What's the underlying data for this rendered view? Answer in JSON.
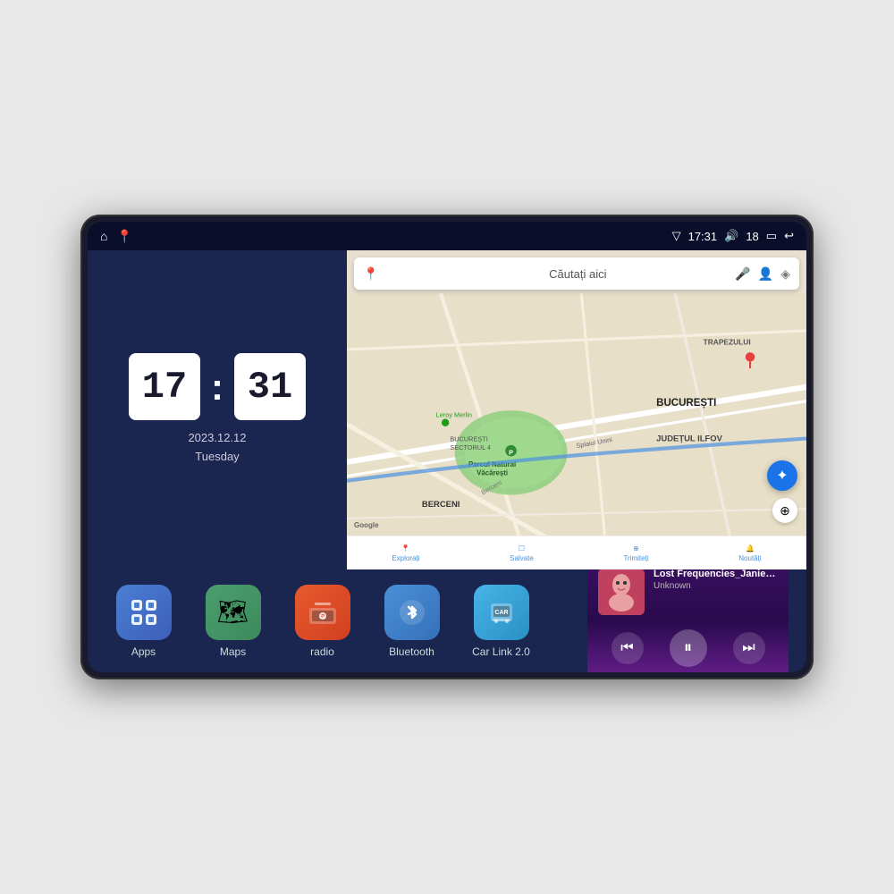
{
  "device": {
    "status_bar": {
      "signal_icon": "▽",
      "time": "17:31",
      "volume_icon": "🔊",
      "battery_level": "18",
      "battery_icon": "▭",
      "back_icon": "↩"
    },
    "home_button": "⌂",
    "maps_shortcut_icon": "📍"
  },
  "clock": {
    "hours": "17",
    "minutes": "31",
    "date": "2023.12.12",
    "day": "Tuesday"
  },
  "map": {
    "search_placeholder": "Căutați aici",
    "nav_items": [
      {
        "label": "Explorați",
        "icon": "📍"
      },
      {
        "label": "Salvate",
        "icon": "☐"
      },
      {
        "label": "Trimiteți",
        "icon": "⊕"
      },
      {
        "label": "Noutăți",
        "icon": "🔔"
      }
    ],
    "labels": [
      "BUCUREȘTI",
      "JUDEȚUL ILFOV",
      "TRAPEZULUI",
      "BERCENI",
      "BUCUREȘTI SECTORUL 4"
    ],
    "google_label": "Google"
  },
  "apps": [
    {
      "id": "apps",
      "label": "Apps",
      "icon": "⊞",
      "bg": "apps-icon-bg"
    },
    {
      "id": "maps",
      "label": "Maps",
      "icon": "🗺",
      "bg": "maps-icon-bg"
    },
    {
      "id": "radio",
      "label": "radio",
      "icon": "📻",
      "bg": "radio-icon-bg"
    },
    {
      "id": "bluetooth",
      "label": "Bluetooth",
      "icon": "⟡",
      "bg": "bt-icon-bg"
    },
    {
      "id": "carlink",
      "label": "Car Link 2.0",
      "icon": "📱",
      "bg": "carlink-icon-bg"
    }
  ],
  "music": {
    "title": "Lost Frequencies_Janieck Devy-...",
    "artist": "Unknown",
    "prev_label": "⏮",
    "play_label": "⏸",
    "next_label": "⏭"
  }
}
